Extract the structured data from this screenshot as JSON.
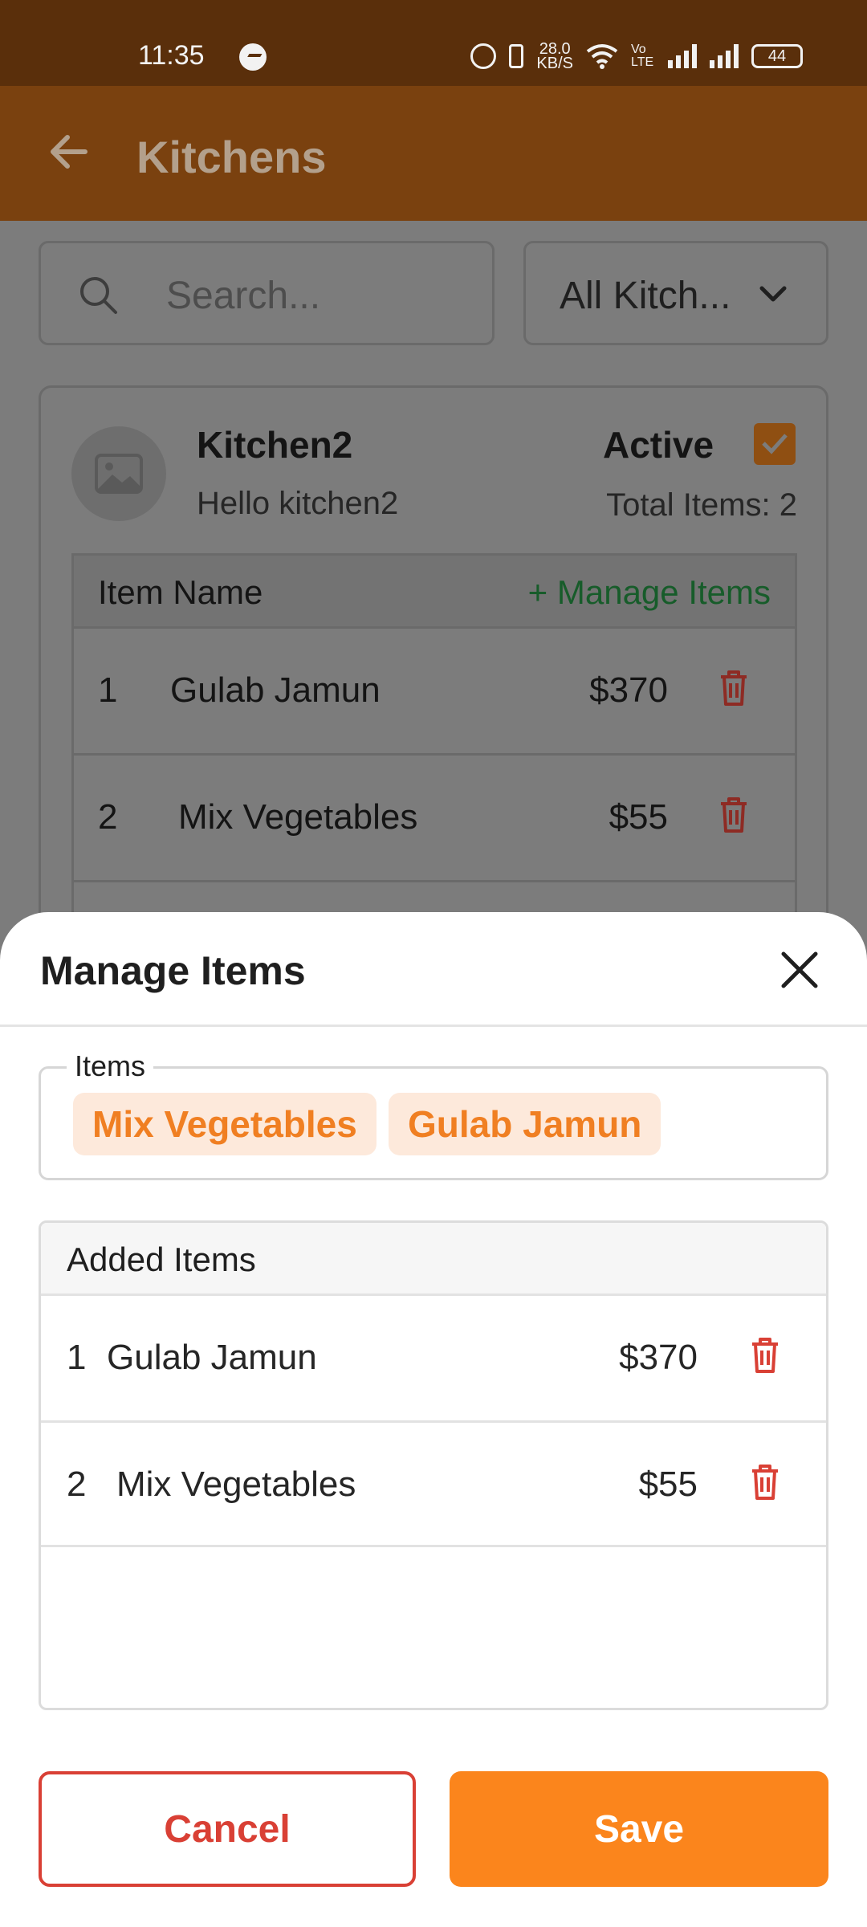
{
  "status_bar": {
    "time": "11:35",
    "speed_top": "28.0",
    "speed_bottom": "KB/S",
    "network": "Vo LTE",
    "battery": "44"
  },
  "app_bar": {
    "title": "Kitchens",
    "back_icon": "arrow-left-icon"
  },
  "filters": {
    "search_placeholder": "Search...",
    "kitchen_filter": "All Kitch..."
  },
  "kitchen_card": {
    "name": "Kitchen2",
    "description": "Hello kitchen2",
    "status": "Active",
    "total_items": "Total Items: 2",
    "table_header": "Item Name",
    "manage_link": "+ Manage Items",
    "rows": [
      {
        "index": "1",
        "name": "Gulab Jamun",
        "price": "$370"
      },
      {
        "index": "2",
        "name": "Mix Vegetables",
        "price": "$55"
      }
    ]
  },
  "sheet": {
    "title": "Manage Items",
    "items_label": "Items",
    "chips": [
      "Mix Vegetables",
      "Gulab Jamun"
    ],
    "added_header": "Added Items",
    "added_rows": [
      {
        "index": "1",
        "name": "Gulab Jamun",
        "price": "$370"
      },
      {
        "index": "2",
        "name": "Mix Vegetables",
        "price": "$55"
      }
    ],
    "cancel_label": "Cancel",
    "save_label": "Save"
  },
  "colors": {
    "accent": "#fb851c",
    "danger": "#d94035",
    "chip_bg": "#fde9db",
    "appbar": "#7a410f"
  }
}
